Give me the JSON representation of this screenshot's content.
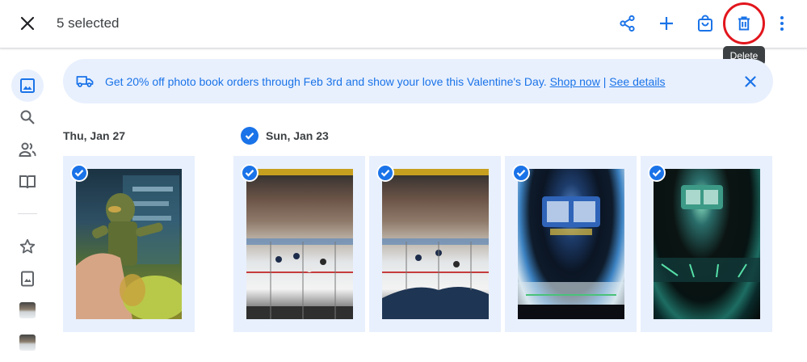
{
  "header": {
    "selected_label": "5 selected",
    "tooltip": "Delete"
  },
  "banner": {
    "text": "Get 20% off photo book orders through Feb 3rd and show your love this Valentine's Day.",
    "shop_link": "Shop now",
    "separator": "|",
    "details_link": "See details"
  },
  "groups": [
    {
      "date": "Thu, Jan 27"
    },
    {
      "date": "Sun, Jan 23"
    }
  ],
  "photos": [
    {
      "group": "Thu, Jan 27",
      "subject": "figure",
      "selected": true
    },
    {
      "group": "Sun, Jan 23",
      "subject": "hockey",
      "selected": true
    },
    {
      "group": "Sun, Jan 23",
      "subject": "hockey",
      "selected": true
    },
    {
      "group": "Sun, Jan 23",
      "subject": "arena",
      "selected": true
    },
    {
      "group": "Sun, Jan 23",
      "subject": "arena-dark",
      "selected": true
    }
  ],
  "colors": {
    "accent": "#1a73e8",
    "banner_bg": "#e8f0fe",
    "highlight_circle": "#e2161d"
  },
  "icons": [
    "close-icon",
    "share-icon",
    "add-icon",
    "shopping-bag-icon",
    "trash-icon",
    "more-vert-icon",
    "photos-icon",
    "search-icon",
    "people-icon",
    "album-icon",
    "star-icon",
    "photo-book-icon",
    "shipping-truck-icon",
    "checkmark-icon"
  ]
}
